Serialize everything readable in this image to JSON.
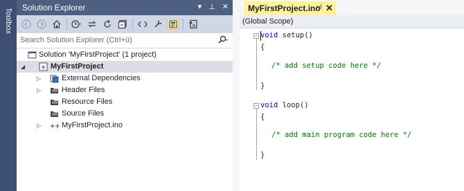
{
  "toolbox": {
    "label": "Toolbox"
  },
  "solution_explorer": {
    "title": "Solution Explorer",
    "title_controls": {
      "dropdown": "▾",
      "pin": "⊥",
      "close": "✕"
    },
    "search": {
      "placeholder": "Search Solution Explorer (Ctrl+ü)"
    },
    "tree": [
      {
        "label": "Solution 'MyFirstProject' (1 project)",
        "icon": "solution-icon"
      },
      {
        "label": "MyFirstProject",
        "icon": "project-icon",
        "expanded": true,
        "bold": true,
        "selected": true
      },
      {
        "label": "External Dependencies",
        "icon": "external-dependencies-icon"
      },
      {
        "label": "Header Files",
        "icon": "folder-icon"
      },
      {
        "label": "Resource Files",
        "icon": "folder-icon"
      },
      {
        "label": "Source Files",
        "icon": "folder-icon"
      },
      {
        "label": "MyFirstProject.ino",
        "icon": "cpp-file-icon"
      }
    ]
  },
  "editor": {
    "tab": {
      "label": "MyFirstProject.ino",
      "pin": "⊣",
      "close": "✕"
    },
    "scope": "(Global Scope)",
    "code": {
      "setup_sig_kw": "void",
      "setup_sig_rest": " setup()",
      "open_brace": "{",
      "setup_comment": "/* add setup code here */",
      "close_brace": "}",
      "loop_sig_kw": "void",
      "loop_sig_rest": " loop()",
      "loop_comment": "/* add main program code here */"
    }
  },
  "colors": {
    "toolbox_strip": "#3d4f72",
    "title_bar": "#4d6082",
    "active_tab": "#fff29d",
    "keyword": "#0000ff",
    "comment": "#008000"
  }
}
